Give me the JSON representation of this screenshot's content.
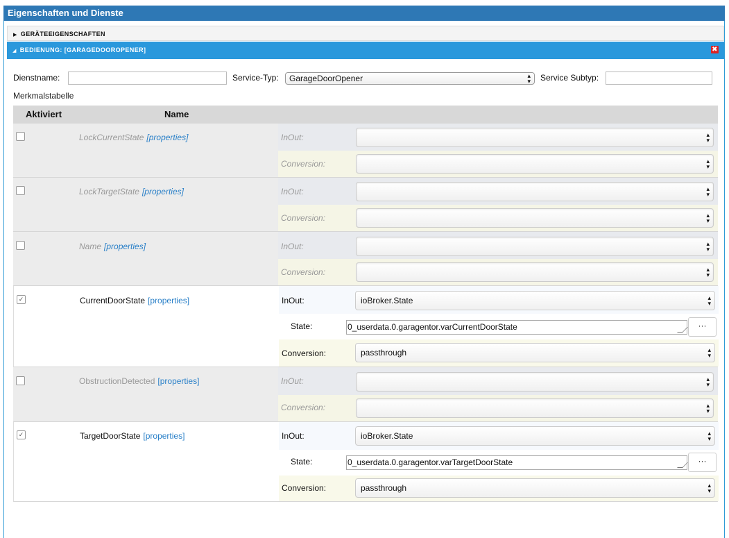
{
  "panel": {
    "title": "Eigenschaften und Dienste"
  },
  "accordion": {
    "device_props": {
      "label": "GERÄTEEIGENSCHAFTEN",
      "icon": "triangle-right-icon"
    },
    "service": {
      "label": "BEDIENUNG: [GARAGEDOOROPENER]",
      "icon": "triangle-down-icon",
      "close_icon": "close-icon",
      "close_glyph": "✖"
    }
  },
  "form": {
    "service_name_label": "Dienstname:",
    "service_name_value": "",
    "service_type_label": "Service-Typ:",
    "service_type_value": "GarageDoorOpener",
    "service_subtype_label": "Service Subtyp:",
    "service_subtype_value": ""
  },
  "table": {
    "caption": "Merkmalstabelle",
    "headers": {
      "activated": "Aktiviert",
      "name": "Name"
    },
    "link_text": "[properties]",
    "inout_label": "InOut:",
    "conversion_label": "Conversion:",
    "state_label": "State:",
    "dots_label": "···",
    "select_arrows": "▲▼",
    "check_glyph": "✓",
    "rows": [
      {
        "name": "LockCurrentState",
        "enabled": false,
        "inout": "",
        "conversion": ""
      },
      {
        "name": "LockTargetState",
        "enabled": false,
        "inout": "",
        "conversion": ""
      },
      {
        "name": "Name",
        "enabled": false,
        "inout": "",
        "conversion": ""
      },
      {
        "name": "CurrentDoorState",
        "enabled": true,
        "inout": "ioBroker.State",
        "state": "0_userdata.0.garagentor.varCurrentDoorState",
        "conversion": "passthrough"
      },
      {
        "name": "ObstructionDetected",
        "enabled": false,
        "inout": "",
        "conversion": ""
      },
      {
        "name": "TargetDoorState",
        "enabled": true,
        "inout": "ioBroker.State",
        "state": "0_userdata.0.garagentor.varTargetDoorState",
        "conversion": "passthrough"
      }
    ]
  }
}
